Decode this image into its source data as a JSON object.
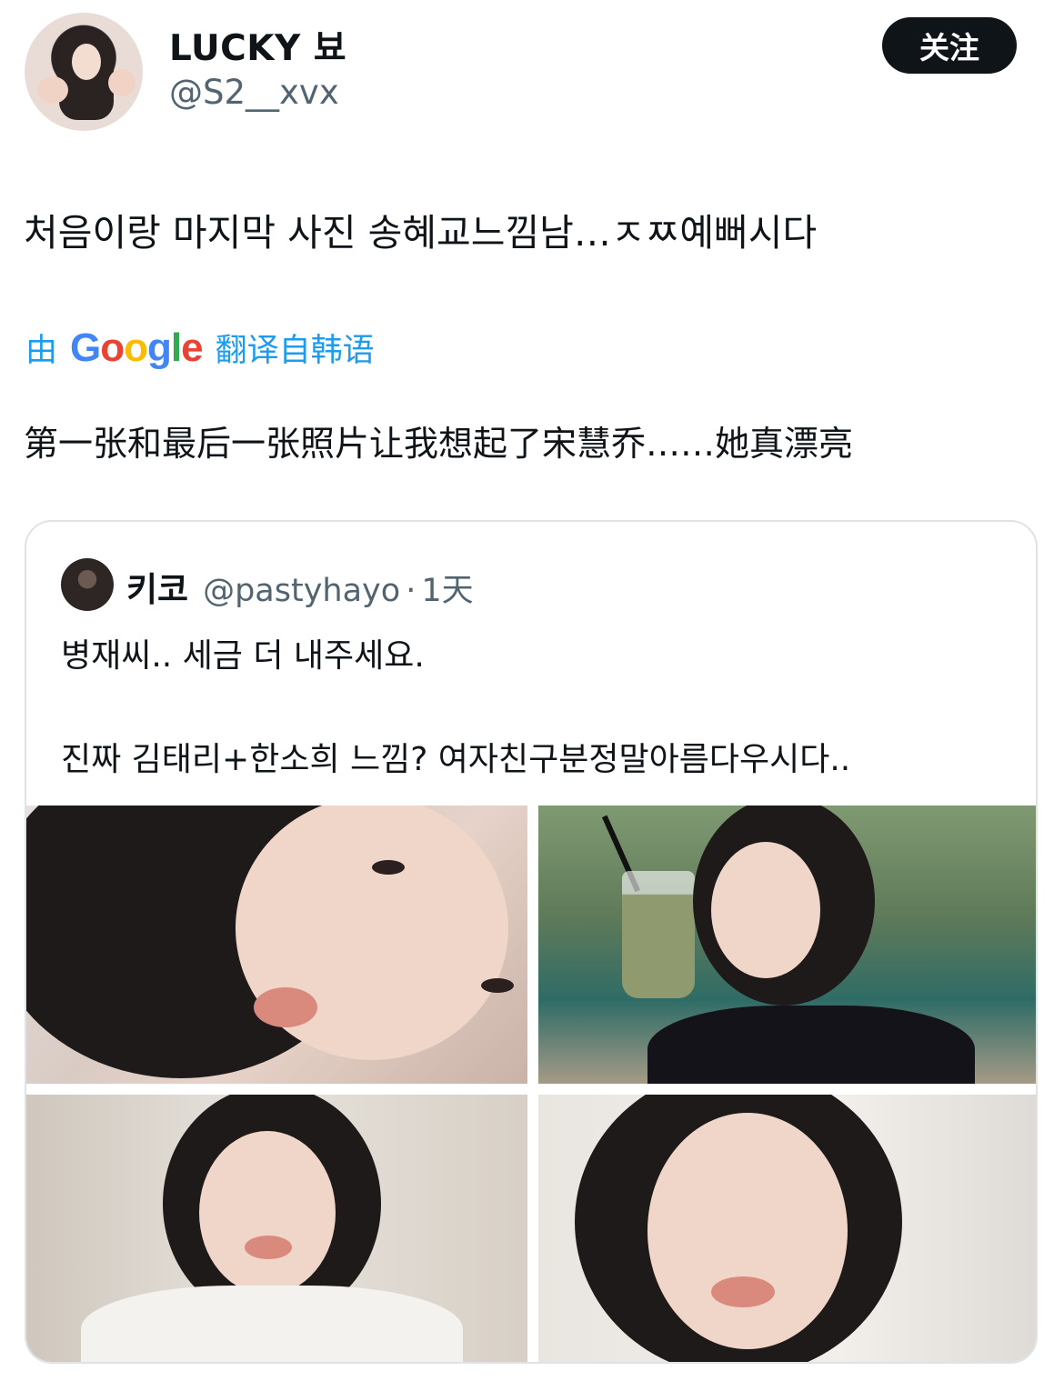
{
  "author": {
    "display_name": "LUCKY 뵤",
    "handle": "@S2__xvx",
    "follow_label": "关注"
  },
  "tweet": {
    "text": "처음이랑 마지막 사진 송혜교느낌남…ㅈㅉ예뻐시다"
  },
  "translation": {
    "prefix": "由",
    "provider_logo_text": "Google",
    "suffix": "翻译自韩语",
    "text": "第一张和最后一张照片让我想起了宋慧乔……她真漂亮"
  },
  "quoted_tweet": {
    "display_name": "키코",
    "handle": "@pastyhayo",
    "separator": "·",
    "time": "1天",
    "text_line1": "병재씨.. 세금 더 내주세요.",
    "text_line2": "진짜 김태리+한소희 느낌? 여자친구분정말아름다우시다..",
    "photo_count": 4
  },
  "colors": {
    "link_blue": "#1d9bf0",
    "secondary_text": "#536471",
    "primary_text": "#0f1419",
    "follow_button_bg": "#0f1419",
    "card_border": "#dfe3e6"
  }
}
